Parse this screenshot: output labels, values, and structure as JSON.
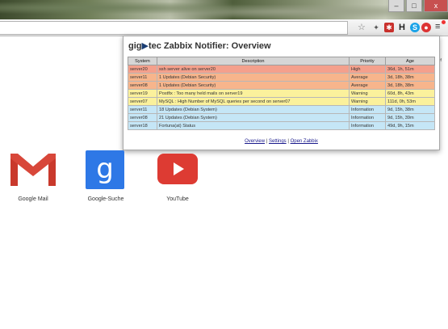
{
  "window": {
    "minimize": "–",
    "maximize": "□",
    "close": "x"
  },
  "toolbar": {
    "icons": [
      "star-icon",
      "puzzle-icon",
      "lastpass-icon",
      "h-icon",
      "skype-icon",
      "zabbix-icon",
      "menu-icon"
    ],
    "ext_h": "H",
    "ext_skype": "S",
    "menu_glyph": "≡"
  },
  "side_text": [
    "def",
    "g"
  ],
  "popup": {
    "title_prefix": "gig",
    "title_arrow": "▶",
    "title_rest": "tec Zabbix Notifier: Overview",
    "columns": [
      "System",
      "Description",
      "Priority",
      "Age"
    ],
    "rows": [
      {
        "system": "server20",
        "description": "ssh server alive on server20",
        "priority": "High",
        "age": "36d, 1h, 51m",
        "color": "#f4a08c"
      },
      {
        "system": "server11",
        "description": "1 Updates (Debian Security)",
        "priority": "Average",
        "age": "3d, 18h, 38m",
        "color": "#f7b58c"
      },
      {
        "system": "server08",
        "description": "1 Updates (Debian Security)",
        "priority": "Average",
        "age": "3d, 18h, 38m",
        "color": "#f7b58c"
      },
      {
        "system": "server19",
        "description": "Postfix : Too many held mails on server19",
        "priority": "Warning",
        "age": "60d, 8h, 43m",
        "color": "#fbf19c"
      },
      {
        "system": "server07",
        "description": "MySQL : High Number of MySQL queries per second on server07",
        "priority": "Warning",
        "age": "111d, 0h, 53m",
        "color": "#fbf19c"
      },
      {
        "system": "server11",
        "description": "18 Updates (Debian System)",
        "priority": "Information",
        "age": "9d, 15h, 38m",
        "color": "#c5e6f6"
      },
      {
        "system": "server08",
        "description": "21 Updates (Debian System)",
        "priority": "Information",
        "age": "9d, 15h, 39m",
        "color": "#c5e6f6"
      },
      {
        "system": "server18",
        "description": "Fortuna(at) Status",
        "priority": "Information",
        "age": "49d, 9h, 15m",
        "color": "#c5e6f6"
      }
    ],
    "links": {
      "overview": "Overview",
      "sep": " | ",
      "settings": "Settings",
      "open": "Open Zabbix"
    }
  },
  "apps": [
    {
      "label": "Google Mail",
      "icon": "gmail-icon"
    },
    {
      "label": "Google-Suche",
      "icon": "google-search-icon",
      "glyph": "g"
    },
    {
      "label": "YouTube",
      "icon": "youtube-icon"
    }
  ]
}
